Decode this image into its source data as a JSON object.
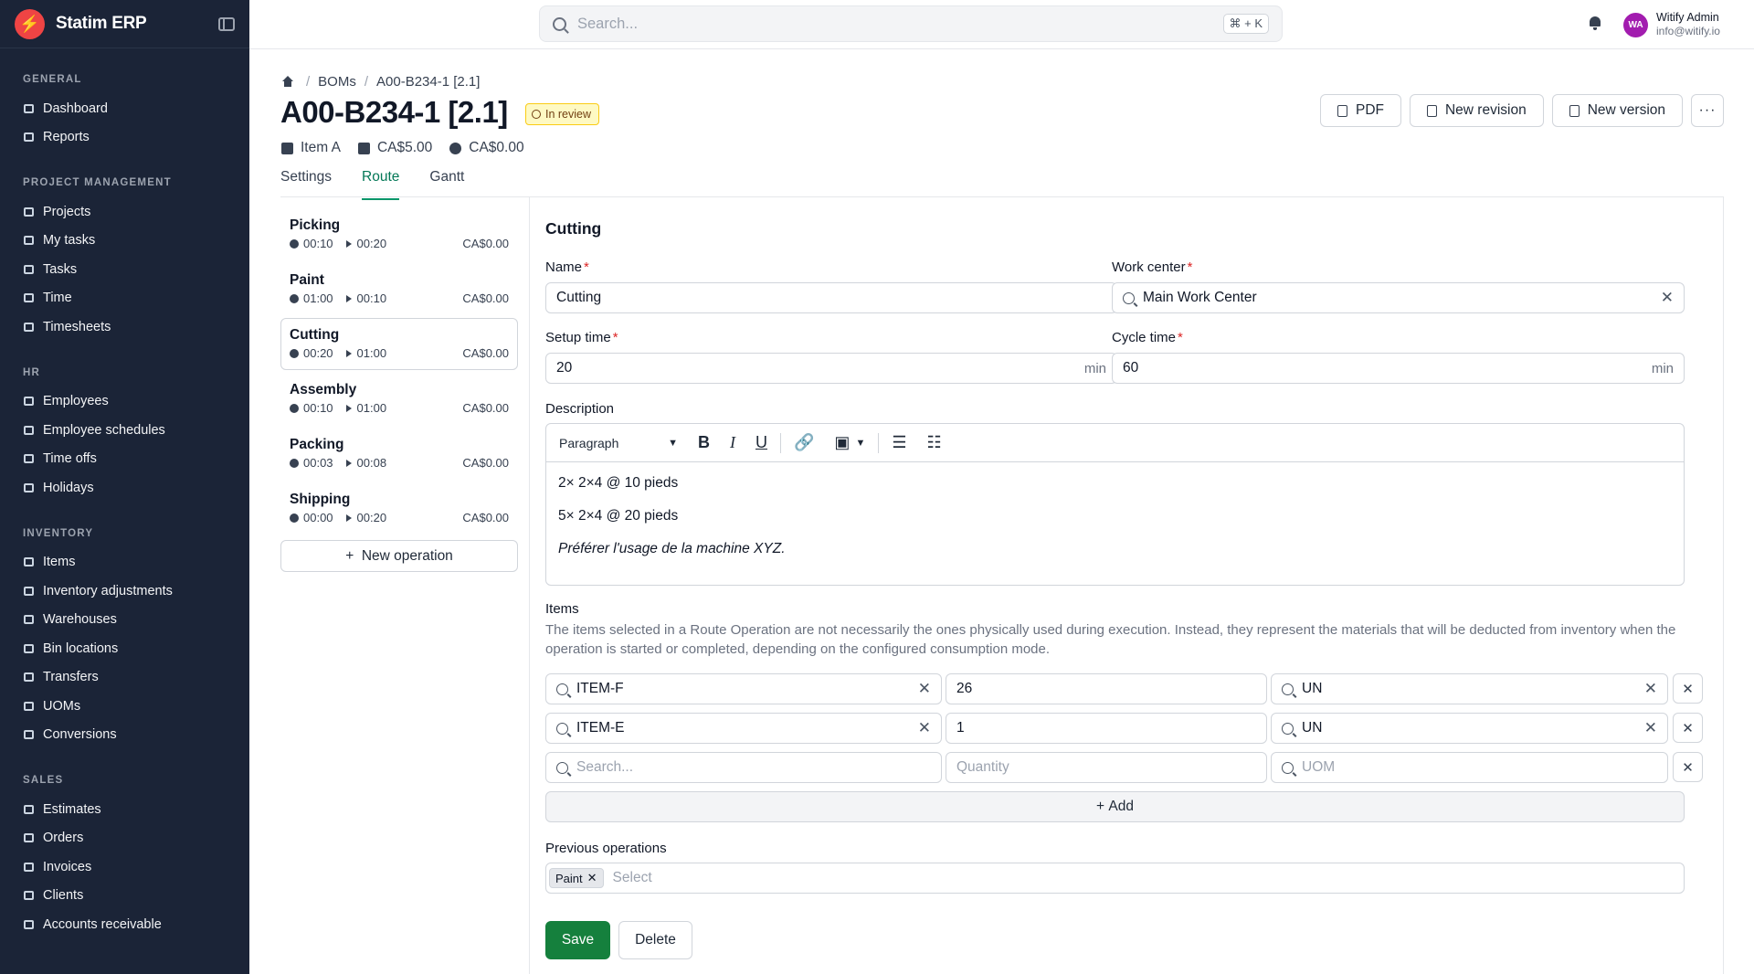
{
  "app": {
    "name": "Statim ERP"
  },
  "sidebar": {
    "sections": [
      {
        "heading": "GENERAL",
        "items": [
          "Dashboard",
          "Reports"
        ]
      },
      {
        "heading": "PROJECT MANAGEMENT",
        "items": [
          "Projects",
          "My tasks",
          "Tasks",
          "Time",
          "Timesheets"
        ]
      },
      {
        "heading": "HR",
        "items": [
          "Employees",
          "Employee schedules",
          "Time offs",
          "Holidays"
        ]
      },
      {
        "heading": "INVENTORY",
        "items": [
          "Items",
          "Inventory adjustments",
          "Warehouses",
          "Bin locations",
          "Transfers",
          "UOMs",
          "Conversions"
        ]
      },
      {
        "heading": "SALES",
        "items": [
          "Estimates",
          "Orders",
          "Invoices",
          "Clients",
          "Accounts receivable"
        ]
      }
    ]
  },
  "search": {
    "placeholder": "Search...",
    "shortcut": "⌘ + K"
  },
  "user": {
    "initials": "WA",
    "name": "Witify Admin",
    "email": "info@witify.io"
  },
  "breadcrumb": {
    "level1": "BOMs",
    "level2": "A00-B234-1 [2.1]"
  },
  "page": {
    "title": "A00-B234-1 [2.1]",
    "status": "In review",
    "meta": {
      "item": "Item A",
      "cost1": "CA$5.00",
      "cost2": "CA$0.00"
    }
  },
  "actions": {
    "pdf": "PDF",
    "new_revision": "New revision",
    "new_version": "New version",
    "more": "···"
  },
  "tabs": {
    "settings": "Settings",
    "route": "Route",
    "gantt": "Gantt"
  },
  "operations": [
    {
      "name": "Picking",
      "setup": "00:10",
      "cycle": "00:20",
      "cost": "CA$0.00"
    },
    {
      "name": "Paint",
      "setup": "01:00",
      "cycle": "00:10",
      "cost": "CA$0.00"
    },
    {
      "name": "Cutting",
      "setup": "00:20",
      "cycle": "01:00",
      "cost": "CA$0.00"
    },
    {
      "name": "Assembly",
      "setup": "00:10",
      "cycle": "01:00",
      "cost": "CA$0.00"
    },
    {
      "name": "Packing",
      "setup": "00:03",
      "cycle": "00:08",
      "cost": "CA$0.00"
    },
    {
      "name": "Shipping",
      "setup": "00:00",
      "cycle": "00:20",
      "cost": "CA$0.00"
    }
  ],
  "new_operation": "New operation",
  "form": {
    "title": "Cutting",
    "name_label": "Name",
    "name_value": "Cutting",
    "work_center_label": "Work center",
    "work_center_value": "Main Work Center",
    "setup_label": "Setup time",
    "setup_value": "20",
    "setup_unit": "min",
    "cycle_label": "Cycle time",
    "cycle_value": "60",
    "cycle_unit": "min",
    "description_label": "Description",
    "paragraph_select": "Paragraph",
    "description_lines": [
      "2× 2×4 @ 10 pieds",
      "5× 2×4 @ 20 pieds",
      "Préférer l'usage de la machine XYZ."
    ],
    "items_label": "Items",
    "items_help": "The items selected in a Route Operation are not necessarily the ones physically used during execution. Instead, they represent the materials that will be deducted from inventory when the operation is started or completed, depending on the configured consumption mode.",
    "items": [
      {
        "item": "ITEM-F",
        "quantity": "26",
        "uom": "UN"
      },
      {
        "item": "ITEM-E",
        "quantity": "1",
        "uom": "UN"
      }
    ],
    "new_item": {
      "item_placeholder": "Search...",
      "quantity_placeholder": "Quantity",
      "uom_placeholder": "UOM"
    },
    "add_label": "Add",
    "previous_label": "Previous operations",
    "previous_chips": [
      "Paint"
    ],
    "previous_placeholder": "Select",
    "save": "Save",
    "delete": "Delete"
  }
}
